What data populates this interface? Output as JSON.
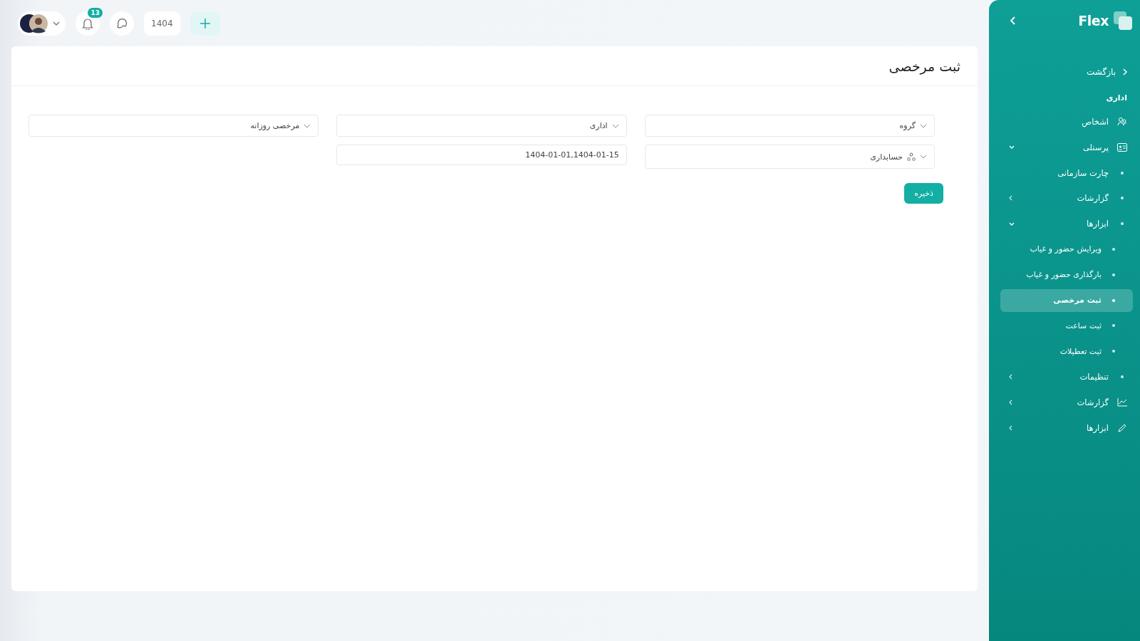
{
  "topbar": {
    "notifications": "13",
    "year": "1404"
  },
  "page": {
    "title": "ثبت مرخصی",
    "save": "ذخیره",
    "fields": [
      {
        "kind": "select",
        "value": "گروه"
      },
      {
        "kind": "select",
        "value": "اداری"
      },
      {
        "kind": "select",
        "value": "مرخصی روزانه"
      },
      {
        "kind": "tree-select",
        "value": "حسابداری"
      },
      {
        "kind": "input",
        "value": "1404-01-01,1404-01-15"
      }
    ]
  },
  "sidebar": {
    "logo": "Flex",
    "back": "بازگشت",
    "section": "اداری",
    "items": [
      {
        "label": "اشخاص",
        "kind": "people",
        "selected": false
      },
      {
        "label": "پرسنلی",
        "kind": "card",
        "selected": false,
        "expanded": true,
        "children": [
          {
            "label": "چارت سازمانی",
            "selected": false
          },
          {
            "label": "گزارشات",
            "selected": false,
            "expanded": false
          },
          {
            "label": "ابزارها",
            "selected": false,
            "expanded": true,
            "children": [
              {
                "label": "ویرایش حضور و غیاب",
                "selected": false
              },
              {
                "label": "بارگذاری حضور و غیاب",
                "selected": false
              },
              {
                "label": "ثبت مرخصی",
                "selected": true
              },
              {
                "label": "ثبت ساعت",
                "selected": false
              },
              {
                "label": "ثبت تعطیلات",
                "selected": false
              }
            ]
          },
          {
            "label": "تنظیمات",
            "selected": false,
            "expanded": false
          }
        ]
      },
      {
        "label": "گزارشات",
        "kind": "chart",
        "selected": false,
        "expanded": false
      },
      {
        "label": "ابزارها",
        "kind": "pencil",
        "selected": false,
        "expanded": false
      }
    ]
  }
}
